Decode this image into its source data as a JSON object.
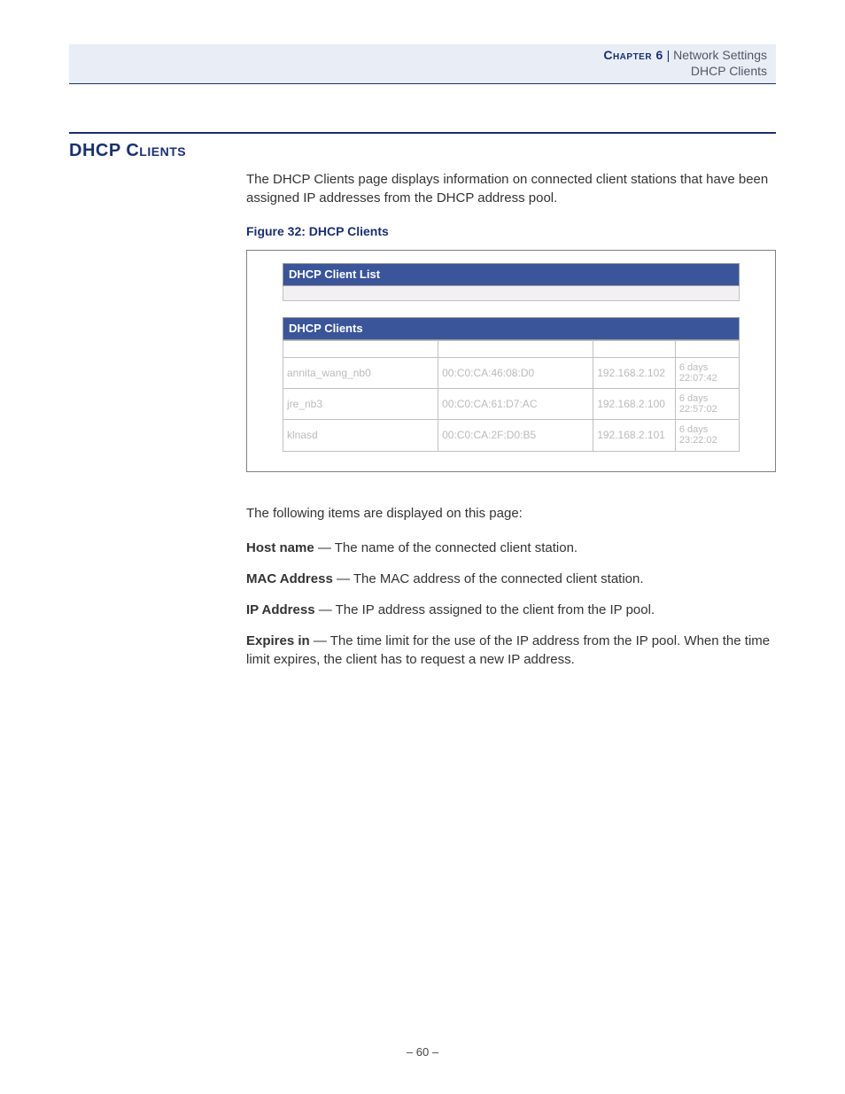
{
  "header": {
    "chapter_label": "Chapter 6",
    "divider": " | ",
    "section": "Network Settings",
    "subsection": "DHCP Clients"
  },
  "title": "DHCP Clients",
  "intro": "The DHCP Clients page displays information on connected client stations that have been assigned IP addresses from the DHCP address pool.",
  "figure_caption": "Figure 32:  DHCP Clients",
  "screenshot": {
    "title1": "DHCP Client List",
    "title2": "DHCP Clients",
    "rows": [
      {
        "host": "annita_wang_nb0",
        "mac": "00:C0:CA:46:08:D0",
        "ip": "192.168.2.102",
        "exp": "6 days 22:07:42"
      },
      {
        "host": "jre_nb3",
        "mac": "00:C0:CA:61:D7:AC",
        "ip": "192.168.2.100",
        "exp": "6 days 22:57:02"
      },
      {
        "host": "klnasd",
        "mac": "00:C0:CA:2F:D0:B5",
        "ip": "192.168.2.101",
        "exp": "6 days 23:22:02"
      }
    ]
  },
  "items_intro": "The following items are displayed on this page:",
  "definitions": [
    {
      "term": "Host name",
      "desc": " — The name of the connected client station."
    },
    {
      "term": "MAC Address",
      "desc": " — The MAC address of the connected client station."
    },
    {
      "term": "IP Address",
      "desc": " — The IP address assigned to the client from the IP pool."
    },
    {
      "term": "Expires in",
      "desc": " — The time limit for the use of the IP address from the IP pool. When the time limit expires, the client has to request a new IP address."
    }
  ],
  "page_number": "–  60  –"
}
